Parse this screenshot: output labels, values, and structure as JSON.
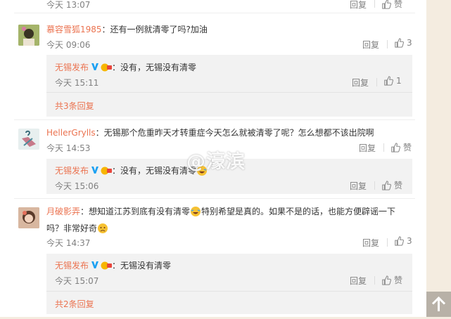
{
  "top_row": {
    "time": "今天 13:07",
    "reply": "回复",
    "like": "赞"
  },
  "comments": [
    {
      "user": "慕容雪狐1985",
      "text": "：还有一例就清零了吗?加油",
      "time": "今天 09:06",
      "reply": "回复",
      "likes": "3",
      "replies": [
        {
          "user": "无锡发布",
          "text": "：没有，无锡没有清零",
          "time": "今天 15:11",
          "reply": "回复",
          "likes": "1"
        }
      ],
      "more": "共3条回复"
    },
    {
      "user": "HellerGrylls",
      "text": "：无锡那个危重昨天才转重症今天怎么就被清零了呢？怎么想都不该出院啊",
      "time": "今天 14:53",
      "reply": "回复",
      "likes": "赞",
      "replies": [
        {
          "user": "无锡发布",
          "text": "：没有，无锡没有清零",
          "time": "今天 15:06",
          "reply": "回复",
          "likes": "赞"
        }
      ]
    },
    {
      "user": "月破影弄",
      "text_a": "：想知道江苏到底有没有清零",
      "text_b": "特别希望是真的。如果不是的话，也能方便辟谣一下",
      "text_c": "吗？非常好奇",
      "time": "今天 14:37",
      "reply": "回复",
      "likes": "3",
      "replies": [
        {
          "user": "无锡发布",
          "text": "：无锡没有清零",
          "time": "今天 15:07",
          "reply": "回复",
          "likes": "赞"
        }
      ],
      "more": "共2条回复"
    }
  ],
  "watermark": "@濠滨",
  "icons": {
    "like": "thumb-up-icon",
    "verified": "verified-v-icon",
    "medal": "fan-medal-icon",
    "back_to_top": "arrow-up-icon"
  },
  "colors": {
    "name": "#eb7350",
    "accent_blue": "#1da1f2",
    "reply_bg": "#f2f2f2"
  }
}
